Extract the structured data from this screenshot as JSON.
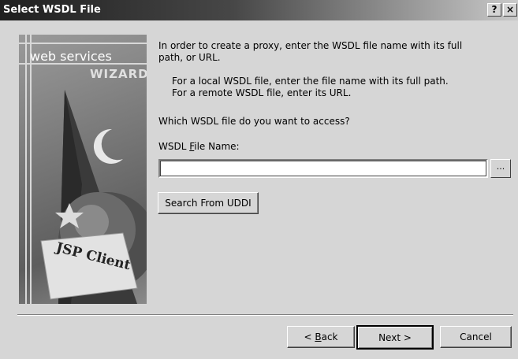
{
  "window": {
    "title": "Select WSDL File",
    "help_label": "?",
    "close_label": "×"
  },
  "banner": {
    "line1": "web services",
    "line2": "WIZARD",
    "badge": "JSP Client"
  },
  "content": {
    "intro_line1": "In order to create a proxy, enter the WSDL file name with its full",
    "intro_line2": "path, or URL.",
    "local_hint": "For a local WSDL file, enter the file name with its full path.",
    "remote_hint": "For a remote WSDL file, enter its URL.",
    "question": "Which WSDL file do you want to access?",
    "field_label_pre": "WSDL ",
    "field_label_key": "F",
    "field_label_post": "ile Name:",
    "field_value": "",
    "browse_label": "...",
    "uddi_button": "Search From UDDI"
  },
  "footer": {
    "back_pre": "< ",
    "back_key": "B",
    "back_post": "ack",
    "next_label": "Next >",
    "cancel_label": "Cancel"
  }
}
